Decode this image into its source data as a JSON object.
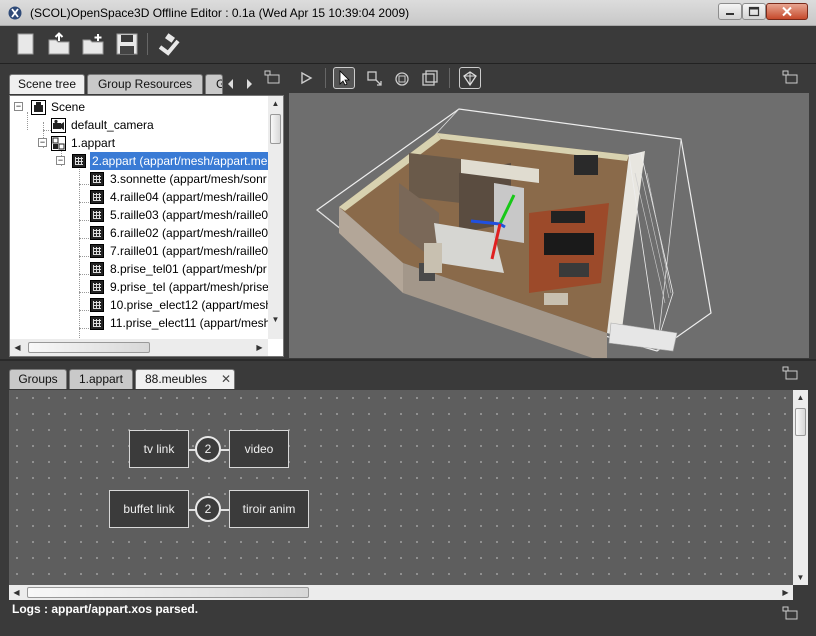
{
  "window": {
    "title": "(SCOL)OpenSpace3D Offline Editor : 0.1a (Wed Apr 15 10:39:04 2009)"
  },
  "toolbar": {
    "buttons": [
      "new-file-icon",
      "open-file-icon",
      "import-folder-icon",
      "save-icon",
      "build-icon"
    ]
  },
  "left_tabs": [
    {
      "label": "Scene tree",
      "active": true
    },
    {
      "label": "Group Resources",
      "active": false
    },
    {
      "label": "G",
      "active": false
    }
  ],
  "tree": [
    {
      "label": "Scene",
      "level": 0,
      "icon": "scene-icon",
      "expander": "−"
    },
    {
      "label": "default_camera",
      "level": 1,
      "icon": "camera-icon"
    },
    {
      "label": "1.appart",
      "level": 1,
      "icon": "group-icon",
      "expander": "−"
    },
    {
      "label": "2.appart (appart/mesh/appart.me",
      "level": 2,
      "icon": "mesh-icon",
      "expander": "−",
      "selected": true
    },
    {
      "label": "3.sonnette (appart/mesh/sonr",
      "level": 3,
      "icon": "mesh-icon"
    },
    {
      "label": "4.raille04 (appart/mesh/raille0",
      "level": 3,
      "icon": "mesh-icon"
    },
    {
      "label": "5.raille03 (appart/mesh/raille0",
      "level": 3,
      "icon": "mesh-icon"
    },
    {
      "label": "6.raille02 (appart/mesh/raille0",
      "level": 3,
      "icon": "mesh-icon"
    },
    {
      "label": "7.raille01 (appart/mesh/raille0",
      "level": 3,
      "icon": "mesh-icon"
    },
    {
      "label": "8.prise_tel01 (appart/mesh/pr",
      "level": 3,
      "icon": "mesh-icon"
    },
    {
      "label": "9.prise_tel (appart/mesh/prise",
      "level": 3,
      "icon": "mesh-icon"
    },
    {
      "label": "10.prise_elect12 (appart/mesh",
      "level": 3,
      "icon": "mesh-icon"
    },
    {
      "label": "11.prise_elect11 (appart/mesh",
      "level": 3,
      "icon": "mesh-icon"
    }
  ],
  "view_toolbar": {
    "buttons": [
      "play-icon",
      "select-cursor-icon",
      "move-icon",
      "rotate-icon",
      "scale-icon",
      "material-icon"
    ]
  },
  "bottom_tabs": [
    {
      "label": "Groups",
      "active": false
    },
    {
      "label": "1.appart",
      "active": false
    },
    {
      "label": "88.meubles",
      "active": true,
      "closable": true
    }
  ],
  "graph": {
    "nodes": [
      {
        "id": "tv-link",
        "label": "tv link"
      },
      {
        "id": "video",
        "label": "video"
      },
      {
        "id": "buffet-link",
        "label": "buffet link"
      },
      {
        "id": "tiroir-anim",
        "label": "tiroir anim"
      }
    ],
    "links": [
      {
        "from": "tv-link",
        "to": "video",
        "count": "2"
      },
      {
        "from": "buffet-link",
        "to": "tiroir-anim",
        "count": "2"
      }
    ]
  },
  "status": {
    "text": "Logs : appart/appart.xos parsed."
  }
}
